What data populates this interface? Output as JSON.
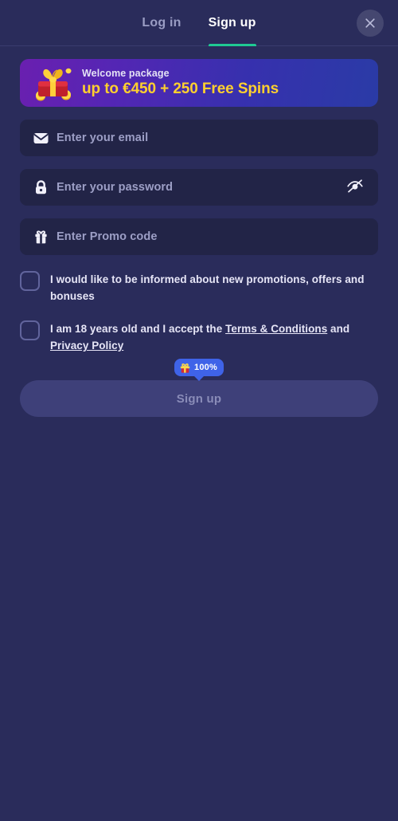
{
  "header": {
    "tabs": [
      {
        "label": "Log in",
        "active": false
      },
      {
        "label": "Sign up",
        "active": true
      }
    ],
    "close_label": "close-icon",
    "accent_color": "#1fca93"
  },
  "promo": {
    "icon": "gift-box-coins-illustration",
    "title": "Welcome package",
    "offer": "up to €450 + 250 Free Spins",
    "offer_color": "#ffd02e",
    "gradient_from": "#6a1fb0",
    "gradient_to": "#2a3ba6"
  },
  "form": {
    "fields": [
      {
        "name": "email",
        "icon": "envelope-icon",
        "placeholder": "Enter your email",
        "value": ""
      },
      {
        "name": "password",
        "icon": "lock-icon",
        "placeholder": "Enter your password",
        "value": "",
        "toggle_icon": "eye-off-icon"
      },
      {
        "name": "promo",
        "icon": "gift-icon",
        "placeholder": "Enter Promo code",
        "value": ""
      }
    ],
    "checkboxes": [
      {
        "name": "promotions",
        "checked": false,
        "text": "I would like to be informed about new promotions, offers and bonuses"
      },
      {
        "name": "age-terms",
        "checked": false,
        "text_before": "I am 18 years old and I accept the ",
        "link_terms": "Terms & Conditions",
        "text_between": " and ",
        "link_privacy": "Privacy Policy"
      }
    ],
    "bonus_badge": {
      "icon": "gift-icon",
      "text": "100%",
      "color": "#3f63e8"
    },
    "submit": {
      "label": "Sign up",
      "disabled": true,
      "bg": "#3e4079",
      "text_color": "#8a8cb8"
    }
  },
  "theme": {
    "page_bg": "#2a2c5b",
    "field_bg": "#222447"
  }
}
